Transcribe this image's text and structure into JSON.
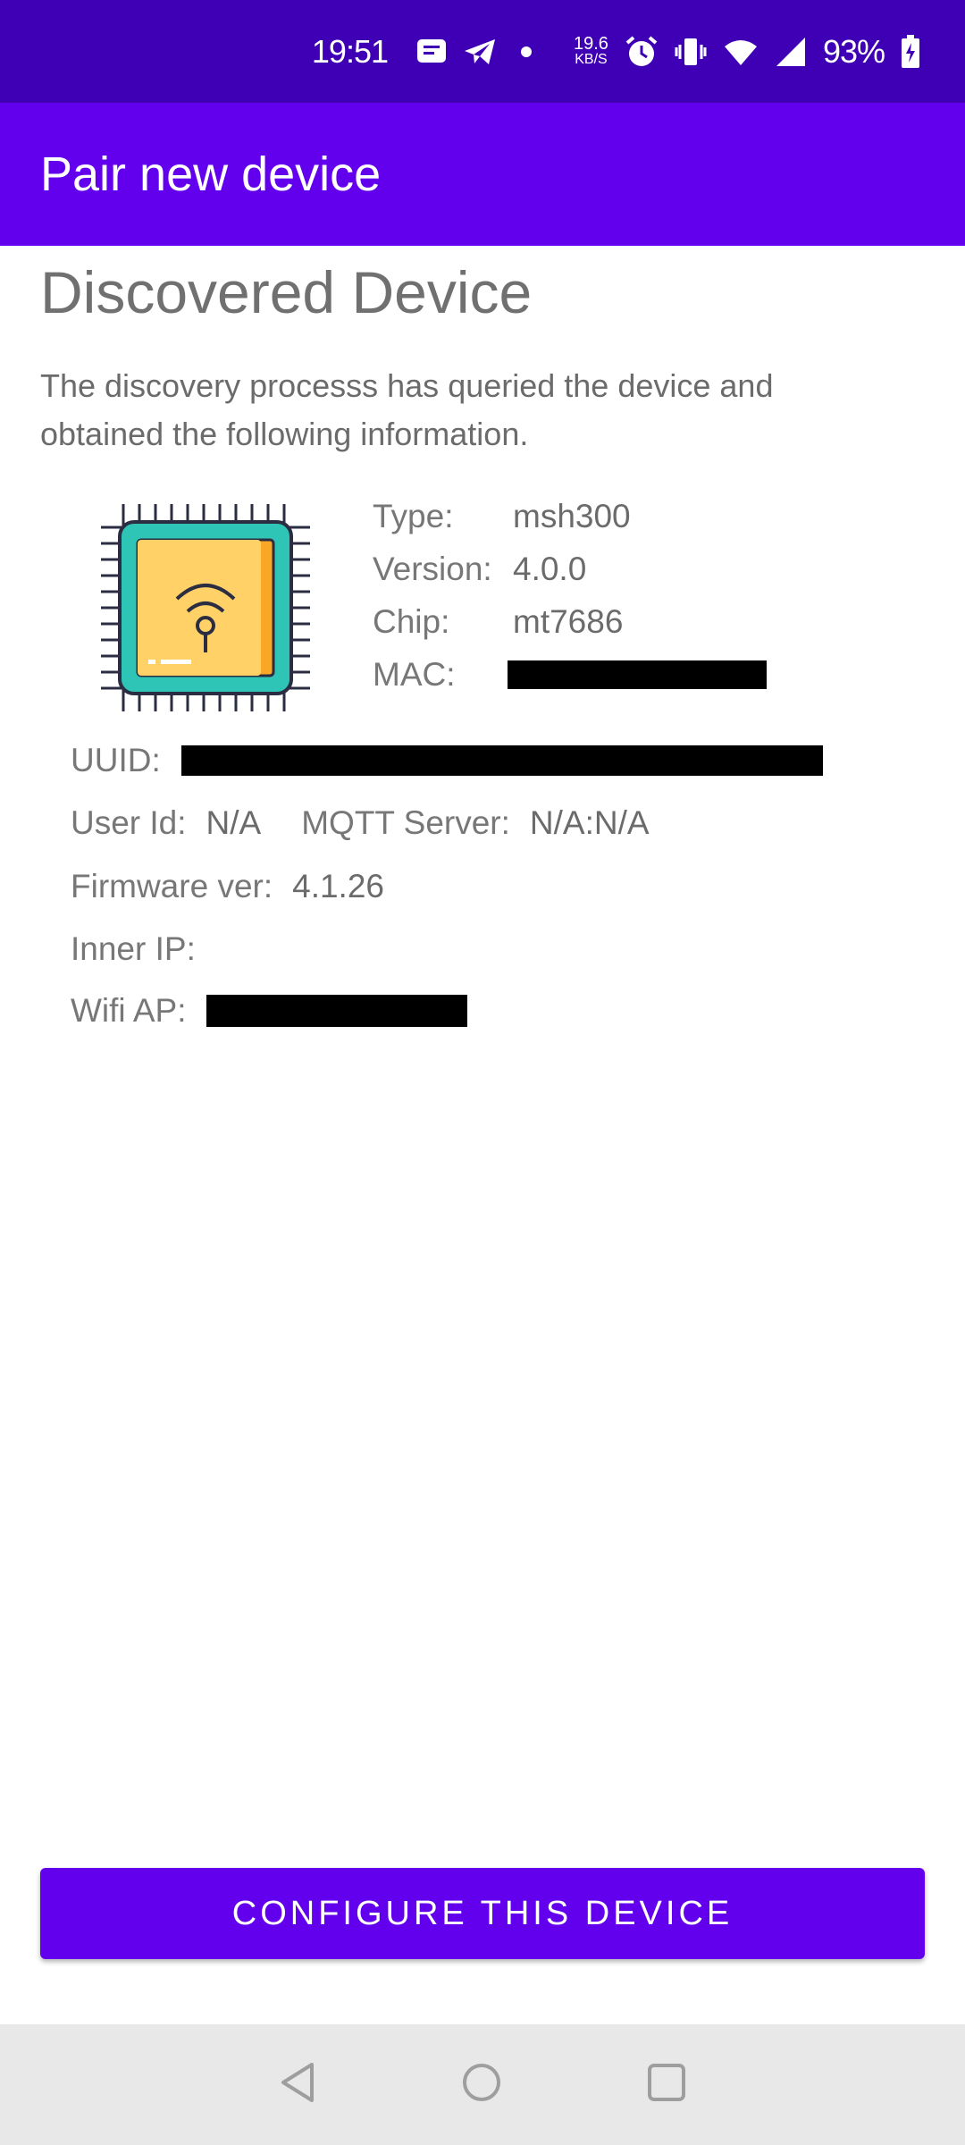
{
  "status_bar": {
    "time": "19:51",
    "net_speed_value": "19.6",
    "net_speed_unit": "KB/S",
    "battery": "93%",
    "icons": [
      "message-icon",
      "telegram-icon",
      "dot-icon",
      "alarm-icon",
      "vibrate-icon",
      "wifi-icon",
      "signal-icon",
      "battery-charging-icon"
    ]
  },
  "app_bar": {
    "title": "Pair new device"
  },
  "main": {
    "heading": "Discovered Device",
    "description": "The discovery processs has queried the device and obtained the following information.",
    "device_info": {
      "type_label": "Type:",
      "type_value": "msh300",
      "version_label": "Version:",
      "version_value": "4.0.0",
      "chip_label": "Chip:",
      "chip_value": "mt7686",
      "mac_label": "MAC:"
    },
    "uuid_label": "UUID:",
    "user_id_label": "User Id:",
    "user_id_value": "N/A",
    "mqtt_label": "MQTT Server:",
    "mqtt_value": "N/A:N/A",
    "firmware_label": "Firmware ver:",
    "firmware_value": "4.1.26",
    "inner_ip_label": "Inner IP:",
    "wifi_ap_label": "Wifi AP:"
  },
  "actions": {
    "configure_label": "CONFIGURE THIS DEVICE"
  },
  "colors": {
    "status_bar": "#3f00b5",
    "primary": "#6200ee",
    "nav_bar": "#e8e8e8"
  }
}
